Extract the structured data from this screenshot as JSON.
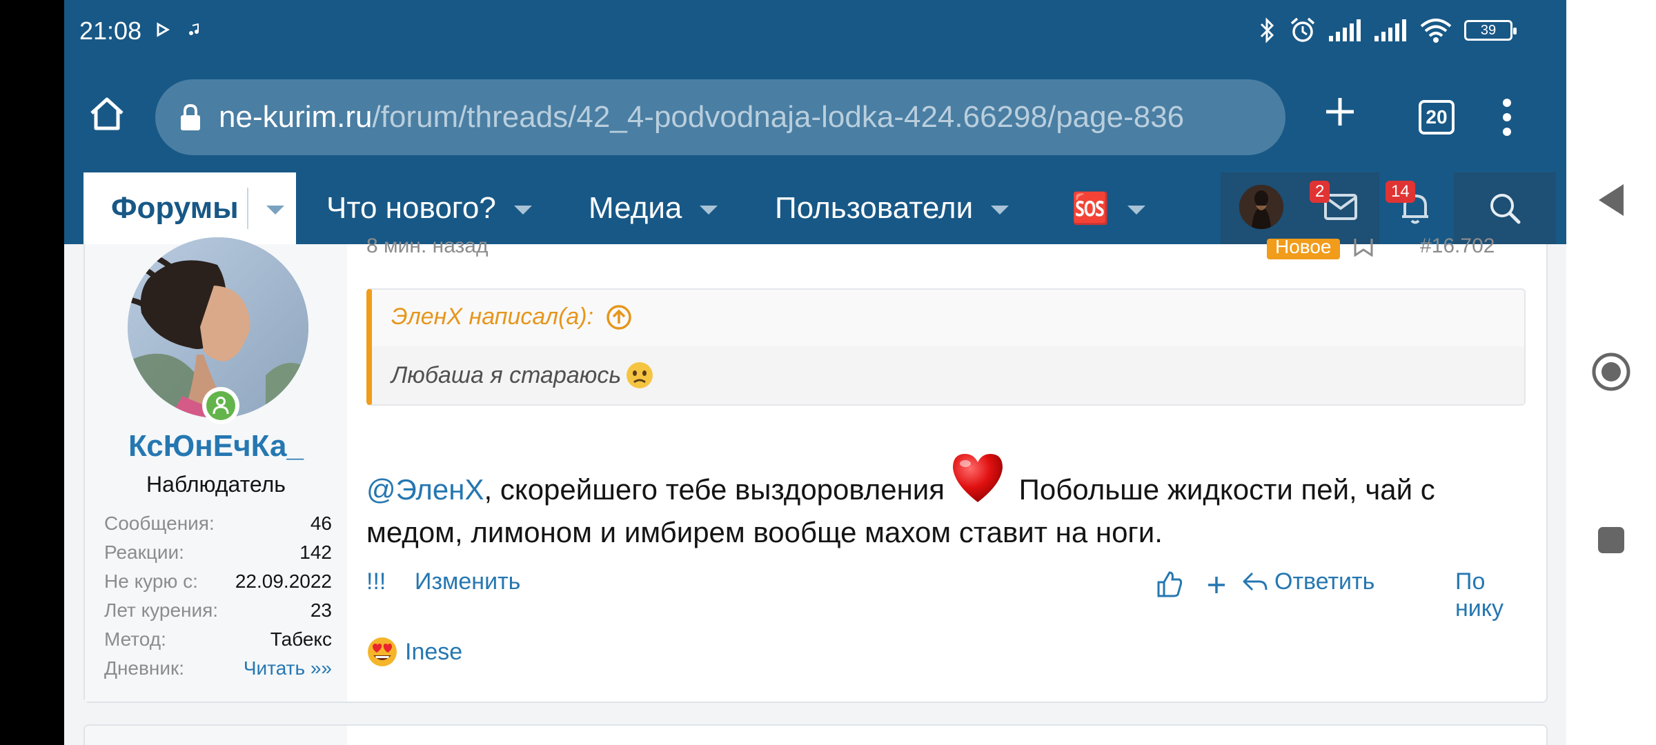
{
  "status_bar": {
    "time": "21:08",
    "battery": "39",
    "icons": [
      "play-icon",
      "music-note-icon",
      "bluetooth-icon",
      "alarm-icon",
      "signal-icon",
      "signal-icon",
      "wifi-icon",
      "battery-icon"
    ]
  },
  "browser": {
    "url_domain": "ne-kurim.ru",
    "url_path": "/forum/threads/42_4-podvodnaja-lodka-424.66298/page-836",
    "tabs_count": "20"
  },
  "forum_nav": {
    "items": [
      {
        "label": "Форумы"
      },
      {
        "label": "Что нового?"
      },
      {
        "label": "Медиа"
      },
      {
        "label": "Пользователи"
      },
      {
        "label": "🆘"
      }
    ],
    "messages_badge": "2",
    "alerts_badge": "14"
  },
  "post": {
    "time": "8 мин. назад",
    "new_tag": "Новое",
    "number": "#16.702",
    "user": {
      "name": "КсЮнЕчКа_",
      "title": "Наблюдатель",
      "stats": [
        {
          "key": "Сообщения:",
          "value": "46"
        },
        {
          "key": "Реакции:",
          "value": "142"
        },
        {
          "key": "Не курю с:",
          "value": "22.09.2022"
        },
        {
          "key": "Лет курения:",
          "value": "23"
        },
        {
          "key": "Метод:",
          "value": "Табекс"
        },
        {
          "key": "Дневник:",
          "value": "Читать »»"
        }
      ]
    },
    "quote": {
      "author": "ЭленХ написал(а):",
      "text": "Любаша я стараюсь"
    },
    "message": {
      "mention": "@ЭленХ",
      "text_before_heart": ", скорейшего тебе выздоровления",
      "text_after_heart": " Побольше жидкости пей, чай с медом, лимоном и имбирем вообще махом ставит на ноги."
    },
    "actions": {
      "report": "!!!",
      "edit": "Изменить",
      "reply": "Ответить",
      "by_nick": "По нику"
    },
    "reaction_user": "Inese"
  },
  "colors": {
    "header": "#185886",
    "link": "#2577b1",
    "accent": "#f19c1b"
  }
}
